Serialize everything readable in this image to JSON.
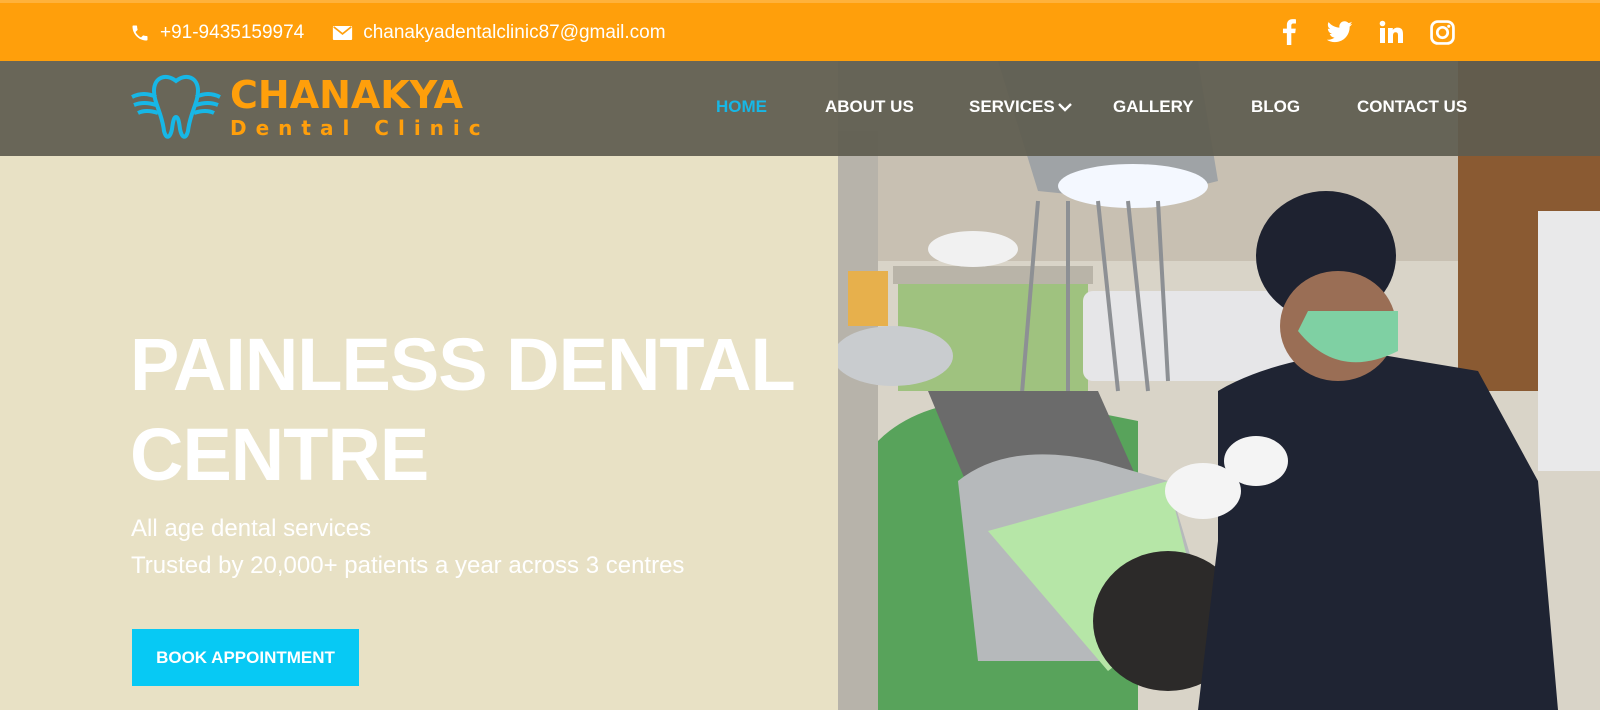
{
  "topbar": {
    "phone": "+91-9435159974",
    "email": "chanakyadentalclinic87@gmail.com",
    "socials": [
      "facebook-icon",
      "twitter-icon",
      "linkedin-icon",
      "instagram-icon"
    ]
  },
  "logo": {
    "brand": "CHANAKYA",
    "tagline": "Dental Clinic"
  },
  "nav": {
    "items": [
      {
        "label": "HOME",
        "active": true
      },
      {
        "label": "ABOUT US"
      },
      {
        "label": "SERVICES",
        "has_dropdown": true
      },
      {
        "label": "GALLERY"
      },
      {
        "label": "BLOG"
      },
      {
        "label": "CONTACT US"
      }
    ]
  },
  "hero": {
    "title_line1": "PAINLESS DENTAL",
    "title_line2": "CENTRE",
    "subtitle_line1": "All age dental services",
    "subtitle_line2": "Trusted by 20,000+ patients a year across 3 centres",
    "cta": "BOOK APPOINTMENT"
  },
  "colors": {
    "accent_orange": "#ff9f0b",
    "accent_cyan": "#07c9f4",
    "hero_bg": "#e8e1c5",
    "nav_bg": "#5f5c50"
  }
}
